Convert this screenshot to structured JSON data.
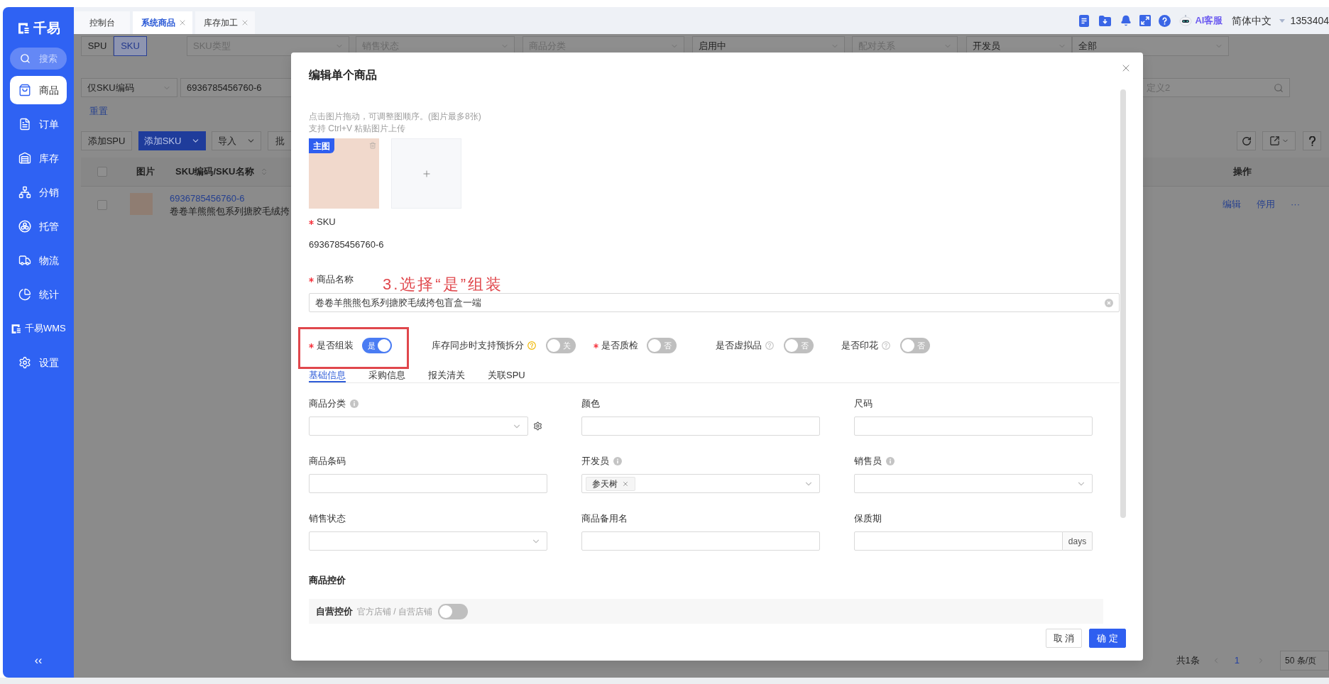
{
  "sidebar": {
    "logo": "千易",
    "search": "搜索",
    "items": [
      {
        "label": "商品",
        "kind": "page",
        "selected": true
      },
      {
        "label": "订单",
        "kind": "page",
        "selected": false
      },
      {
        "label": "库存",
        "kind": "page",
        "selected": false
      },
      {
        "label": "分销",
        "kind": "page",
        "selected": false
      },
      {
        "label": "托管",
        "kind": "page",
        "selected": false
      },
      {
        "label": "物流",
        "kind": "page",
        "selected": false
      },
      {
        "label": "统计",
        "kind": "page",
        "selected": false
      },
      {
        "label": "千易WMS",
        "kind": "brand",
        "selected": false
      },
      {
        "label": "设置",
        "kind": "page",
        "selected": false
      }
    ],
    "collapse": "‹‹"
  },
  "header": {
    "tabs": [
      {
        "label": "控制台",
        "selected": false,
        "closable": false
      },
      {
        "label": "系统商品",
        "selected": true,
        "closable": true
      },
      {
        "label": "库存加工",
        "selected": false,
        "closable": true
      }
    ],
    "assistant": "AI客服",
    "language": "简体中文",
    "account": "1353404"
  },
  "filters": {
    "view_toggle": [
      {
        "label": "SPU",
        "selected": false
      },
      {
        "label": "SKU",
        "selected": true
      }
    ],
    "selects": [
      {
        "placeholder": "SKU类型"
      },
      {
        "placeholder": "销售状态"
      },
      {
        "placeholder": "商品分类"
      },
      {
        "value": "启用中"
      },
      {
        "placeholder": "配对关系"
      },
      {
        "value": "开发员"
      },
      {
        "value": "全部"
      }
    ],
    "search_type": "仅SKU编码",
    "search_value": "6936785456760-6",
    "custom_search": {
      "placeholder": "定义2"
    },
    "reset": "重置"
  },
  "toolbar": {
    "buttons": [
      {
        "label": "添加SPU",
        "kind": "default"
      },
      {
        "label": "添加SKU",
        "kind": "primary-dropdown"
      },
      {
        "label": "导入",
        "kind": "dropdown"
      },
      {
        "label": "批",
        "kind": "default"
      }
    ]
  },
  "table": {
    "all_checked": false,
    "columns": [
      {
        "label": "图片"
      },
      {
        "label": "SKU编码/SKU名称",
        "sortable": true
      },
      {
        "label": "操作"
      }
    ],
    "rows": [
      {
        "checked": false,
        "sku": "6936785456760-6",
        "name": "卷卷羊熊熊包系列搪胶毛绒挎",
        "actions": [
          "编辑",
          "停用",
          "···"
        ]
      }
    ]
  },
  "pagination": {
    "total": "共1条",
    "page": "1",
    "page_size": "50 条/页"
  },
  "modal": {
    "title": "编辑单个商品",
    "image_hints": [
      "点击图片拖动，可调整图顺序。(图片最多8张)",
      "支持 Ctrl+V 粘贴图片上传"
    ],
    "images": [
      {
        "badge": "主图"
      }
    ],
    "sku": {
      "label": "SKU",
      "required": true,
      "value": "6936785456760-6"
    },
    "name": {
      "label": "商品名称",
      "required": true,
      "value": "卷卷羊熊熊包系列搪胶毛绒挎包盲盒一端"
    },
    "annotation": "3.选择“是”组装",
    "switches": [
      {
        "label": "是否组装",
        "required": true,
        "on": true,
        "text": "是",
        "highlighted": true
      },
      {
        "label": "库存同步时支持预拆分",
        "required": false,
        "help": {
          "kind": "warning"
        },
        "on": false,
        "text": "关",
        "highlighted": false
      },
      {
        "label": "是否质检",
        "required": true,
        "on": false,
        "text": "否",
        "highlighted": false
      },
      {
        "label": "是否虚拟品",
        "required": false,
        "help": {
          "kind": "muted"
        },
        "on": false,
        "text": "否",
        "highlighted": false
      },
      {
        "label": "是否印花",
        "required": false,
        "help": {
          "kind": "muted"
        },
        "on": false,
        "text": "否",
        "highlighted": false
      }
    ],
    "tabs": [
      {
        "label": "基础信息",
        "selected": true
      },
      {
        "label": "采购信息",
        "selected": false
      },
      {
        "label": "报关清关",
        "selected": false
      },
      {
        "label": "关联SPU",
        "selected": false
      }
    ],
    "fields": [
      {
        "label": "商品分类",
        "info": true,
        "kind": "select",
        "settings": true
      },
      {
        "label": "颜色",
        "kind": "input"
      },
      {
        "label": "尺码",
        "kind": "input"
      },
      {
        "label": "商品条码",
        "kind": "input"
      },
      {
        "label": "开发员",
        "info": true,
        "kind": "tag-select",
        "tags": [
          "参天树"
        ]
      },
      {
        "label": "销售员",
        "info": true,
        "kind": "select"
      },
      {
        "label": "销售状态",
        "kind": "select"
      },
      {
        "label": "商品备用名",
        "kind": "input"
      },
      {
        "label": "保质期",
        "kind": "addon-input",
        "addon": "days"
      }
    ],
    "price_control": {
      "title": "商品控价",
      "rows": [
        {
          "label": "自营控价",
          "hint": "官方店铺 / 自营店铺",
          "on": false
        }
      ]
    },
    "buttons": [
      {
        "label": "取 消",
        "kind": "default"
      },
      {
        "label": "确 定",
        "kind": "primary"
      }
    ]
  }
}
